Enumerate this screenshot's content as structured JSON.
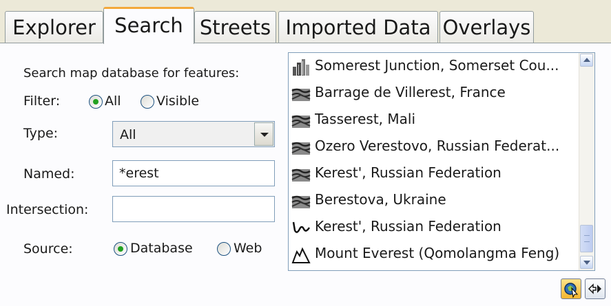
{
  "tabs": [
    {
      "label": "Explorer"
    },
    {
      "label": "Search",
      "active": true
    },
    {
      "label": "Streets"
    },
    {
      "label": "Imported Data"
    },
    {
      "label": "Overlays"
    }
  ],
  "search": {
    "heading": "Search map database for features:",
    "filter": {
      "label": "Filter:",
      "options": [
        "All",
        "Visible"
      ],
      "selected": "All"
    },
    "type": {
      "label": "Type:",
      "value": "All"
    },
    "named": {
      "label": "Named:",
      "value": "*erest"
    },
    "intersection": {
      "label": "Intersection:",
      "value": ""
    },
    "source": {
      "label": "Source:",
      "options": [
        "Database",
        "Web"
      ],
      "selected": "Database"
    }
  },
  "results": [
    {
      "icon": "city-icon",
      "text": "Somerest Junction, Somerset Cou..."
    },
    {
      "icon": "dam-icon",
      "text": "Barrage de Villerest, France"
    },
    {
      "icon": "dam-icon",
      "text": "Tasserest, Mali"
    },
    {
      "icon": "dam-icon",
      "text": "Ozero Verestovo, Russian Federat..."
    },
    {
      "icon": "dam-icon",
      "text": "Kerest', Russian Federation"
    },
    {
      "icon": "dam-icon",
      "text": "Berestova, Ukraine"
    },
    {
      "icon": "river-icon",
      "text": "Kerest', Russian Federation"
    },
    {
      "icon": "mountain-icon",
      "text": "Mount Everest (Qomolangma Feng)"
    }
  ],
  "colors": {
    "active_tab_accent": "#f3a83a",
    "radio_selected": "#21a121",
    "panel_bg": "#fcfcfe",
    "chrome_bg": "#ece9d8"
  }
}
